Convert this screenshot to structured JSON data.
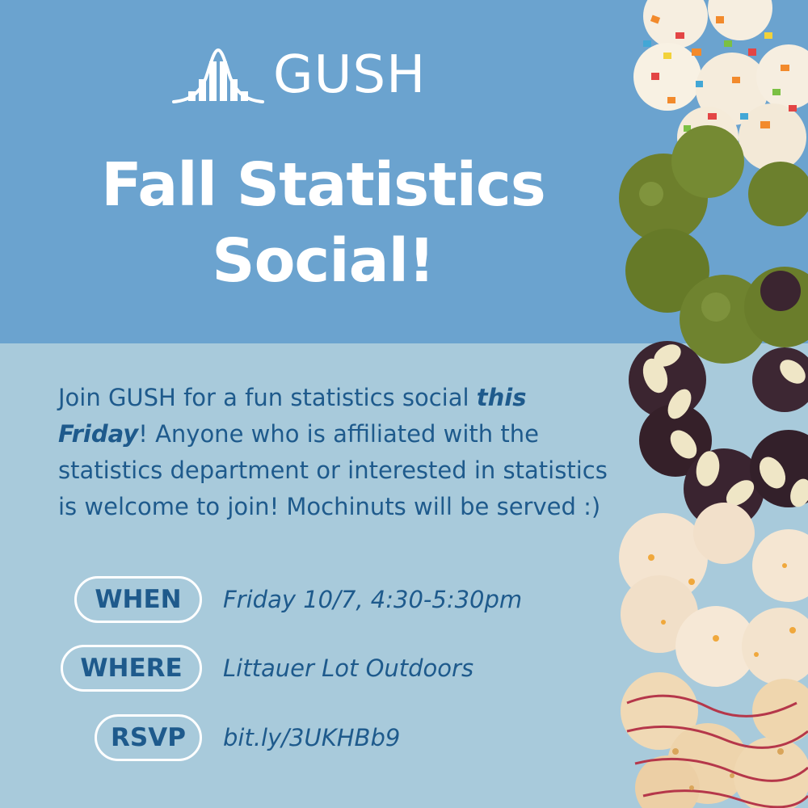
{
  "brand": {
    "logo_text": "GUSH"
  },
  "title": {
    "line1": "Fall Statistics",
    "line2": "Social!"
  },
  "description": {
    "part1": "Join GUSH for a fun statistics social ",
    "emphasis": "this Friday",
    "part2": "! Anyone who is affiliated with the statistics department or interested in statistics is welcome to join! Mochinuts will be served :)"
  },
  "details": [
    {
      "label": "WHEN",
      "value": "Friday 10/7, 4:30-5:30pm"
    },
    {
      "label": "WHERE",
      "value": "Littauer Lot Outdoors"
    },
    {
      "label": "RSVP",
      "value": "bit.ly/3UKHBb9"
    }
  ],
  "colors": {
    "top_band": "#6ba3cf",
    "bottom_band": "#a8cadb",
    "text_dark_blue": "#1e5a8c",
    "white": "#ffffff"
  },
  "image": {
    "subject": "stack of mochi donuts (pon de ring)"
  }
}
